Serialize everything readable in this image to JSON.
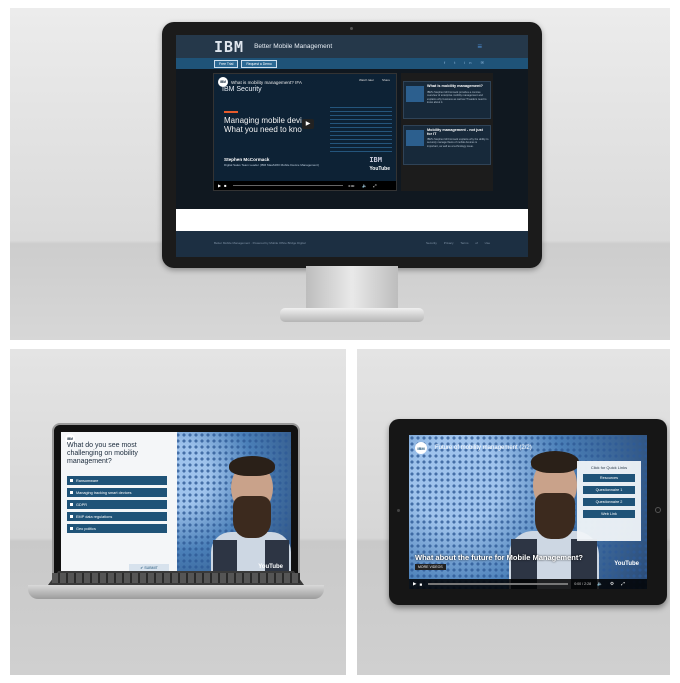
{
  "desktop": {
    "header": {
      "logo": "IBM",
      "title": "Better Mobile Management"
    },
    "nav_buttons": [
      "Free Trial",
      "Request a Demo"
    ],
    "video": {
      "badge": "IBM",
      "title": "What is mobility management? IFA",
      "brand": "IBM Security",
      "watch_later": "Watch later",
      "share": "Share",
      "headline": "Managing mobile devi What you need to kno",
      "speaker": "Stephen McCormack",
      "speaker_role": "Digital Sales Team Leader (IBM MaaS360 Mobile Device Management)",
      "logo": "IBM",
      "youtube": "YouTube",
      "time": "0:00"
    },
    "sidebar_cards": [
      {
        "title": "What is mobility management?",
        "text": "IBM's Stephen McCormack provides a concise overview of enterprise mobility management and explains why business as well as IT leaders need to know about it."
      },
      {
        "title": "Mobility management - not just for IT",
        "text": "IBM's Stephen McCormack explains why the ability to securely manage fleets of mobile devices is important, as well as a technology issue."
      }
    ],
    "footer": {
      "text": "Better Mobile Management · Powered by Mobile Office Bridge Digital",
      "links": "Security Privacy Terms of Use"
    }
  },
  "laptop": {
    "badge": "IBM",
    "question": "What do you see most challenging on mobility management?",
    "options": [
      "Ransomware",
      "Managing tracking smart devices",
      "GDPR",
      "EMP data regulations",
      "Geo politics"
    ],
    "submit": "SUBMIT",
    "youtube": "YouTube"
  },
  "tablet": {
    "badge": "IBM",
    "title": "Future of mobility management (2/2)",
    "quick_links_header": "Click for Quick Links",
    "quick_links": [
      "Resources",
      "Questionnaire 1",
      "Questionnaire 2",
      "Web Link"
    ],
    "caption": "What about the future for Mobile Management?",
    "more_videos": "MORE VIDEOS",
    "youtube": "YouTube",
    "time": "0:00 / 2:28"
  }
}
